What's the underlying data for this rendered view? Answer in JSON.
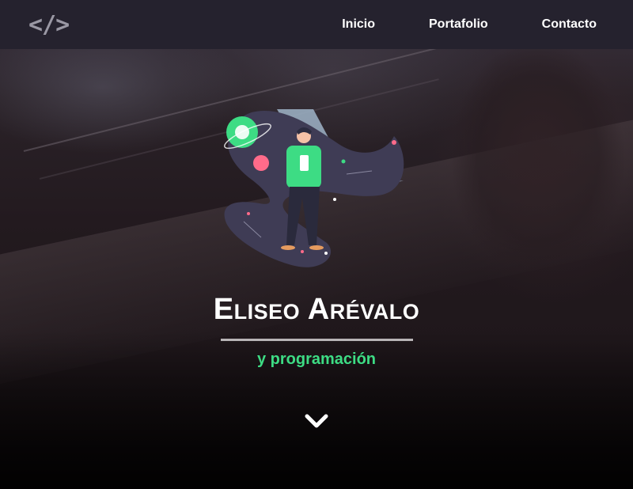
{
  "navbar": {
    "logo": "</>",
    "links": [
      "Inicio",
      "Portafolio",
      "Contacto"
    ]
  },
  "hero": {
    "title": "Eliseo Arévalo",
    "subtitle": "y programación",
    "scroll_icon": "chevron-down-icon",
    "illustration": "astronaut-space-illustration"
  },
  "colors": {
    "navbar_bg": "#25222e",
    "accent_green": "#3ddc84",
    "divider": "#b8b4b6",
    "logo": "#9a98a4"
  }
}
